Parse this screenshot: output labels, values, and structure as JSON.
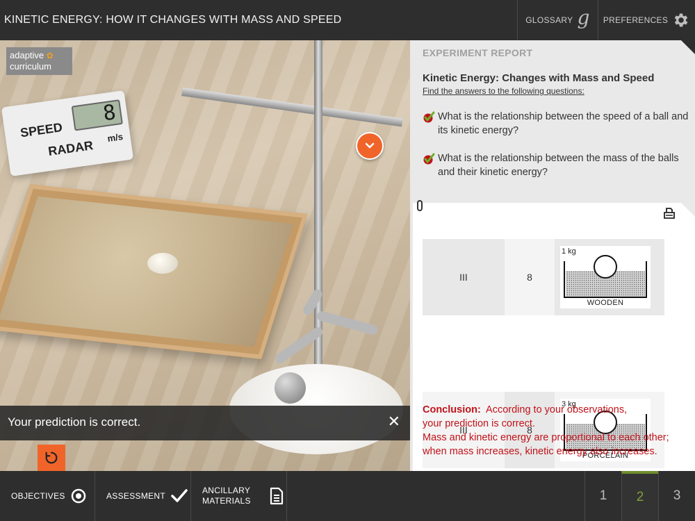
{
  "header": {
    "title": "KINETIC ENERGY: HOW IT CHANGES WITH MASS AND SPEED",
    "glossary_label": "GLOSSARY",
    "preferences_label": "PREFERENCES"
  },
  "logo": {
    "line1": "adaptive",
    "line2": "curriculum"
  },
  "radar": {
    "speed_label": "SPEED",
    "radar_label": "RADAR",
    "reading": "8",
    "unit": "m/s"
  },
  "prediction": {
    "message": "Your prediction is correct."
  },
  "report": {
    "header": "EXPERIMENT REPORT",
    "title": "Kinetic Energy: Changes with Mass and Speed",
    "subtitle": "Find the answers to the following questions:",
    "questions": [
      "What is the relationship between the speed of a ball and its kinetic energy?",
      "What is the relationship between the mass of the balls and their kinetic energy?"
    ],
    "rows": [
      {
        "level": "III",
        "speed": "8",
        "mass": "1 kg",
        "material": "WOODEN"
      },
      {
        "level": "III",
        "speed": "8",
        "mass": "3 kg",
        "material": "PORCELAIN"
      }
    ],
    "conclusion": {
      "label": "Conclusion:",
      "line1": "According to your observations,",
      "line2": "your prediction is correct.",
      "line3": "Mass and kinetic energy are proportional to each other; when mass increases, kinetic energy also increases."
    }
  },
  "footer": {
    "objectives_label": "OBJECTIVES",
    "assessment_label": "ASSESSMENT",
    "ancillary_line1": "ANCILLARY",
    "ancillary_line2": "MATERIALS",
    "pages": [
      "1",
      "2",
      "3"
    ],
    "active_page": "2"
  },
  "colors": {
    "accent_orange": "#f0642a",
    "conclusion_red": "#c0121a",
    "active_page_green": "#7fa13a"
  }
}
